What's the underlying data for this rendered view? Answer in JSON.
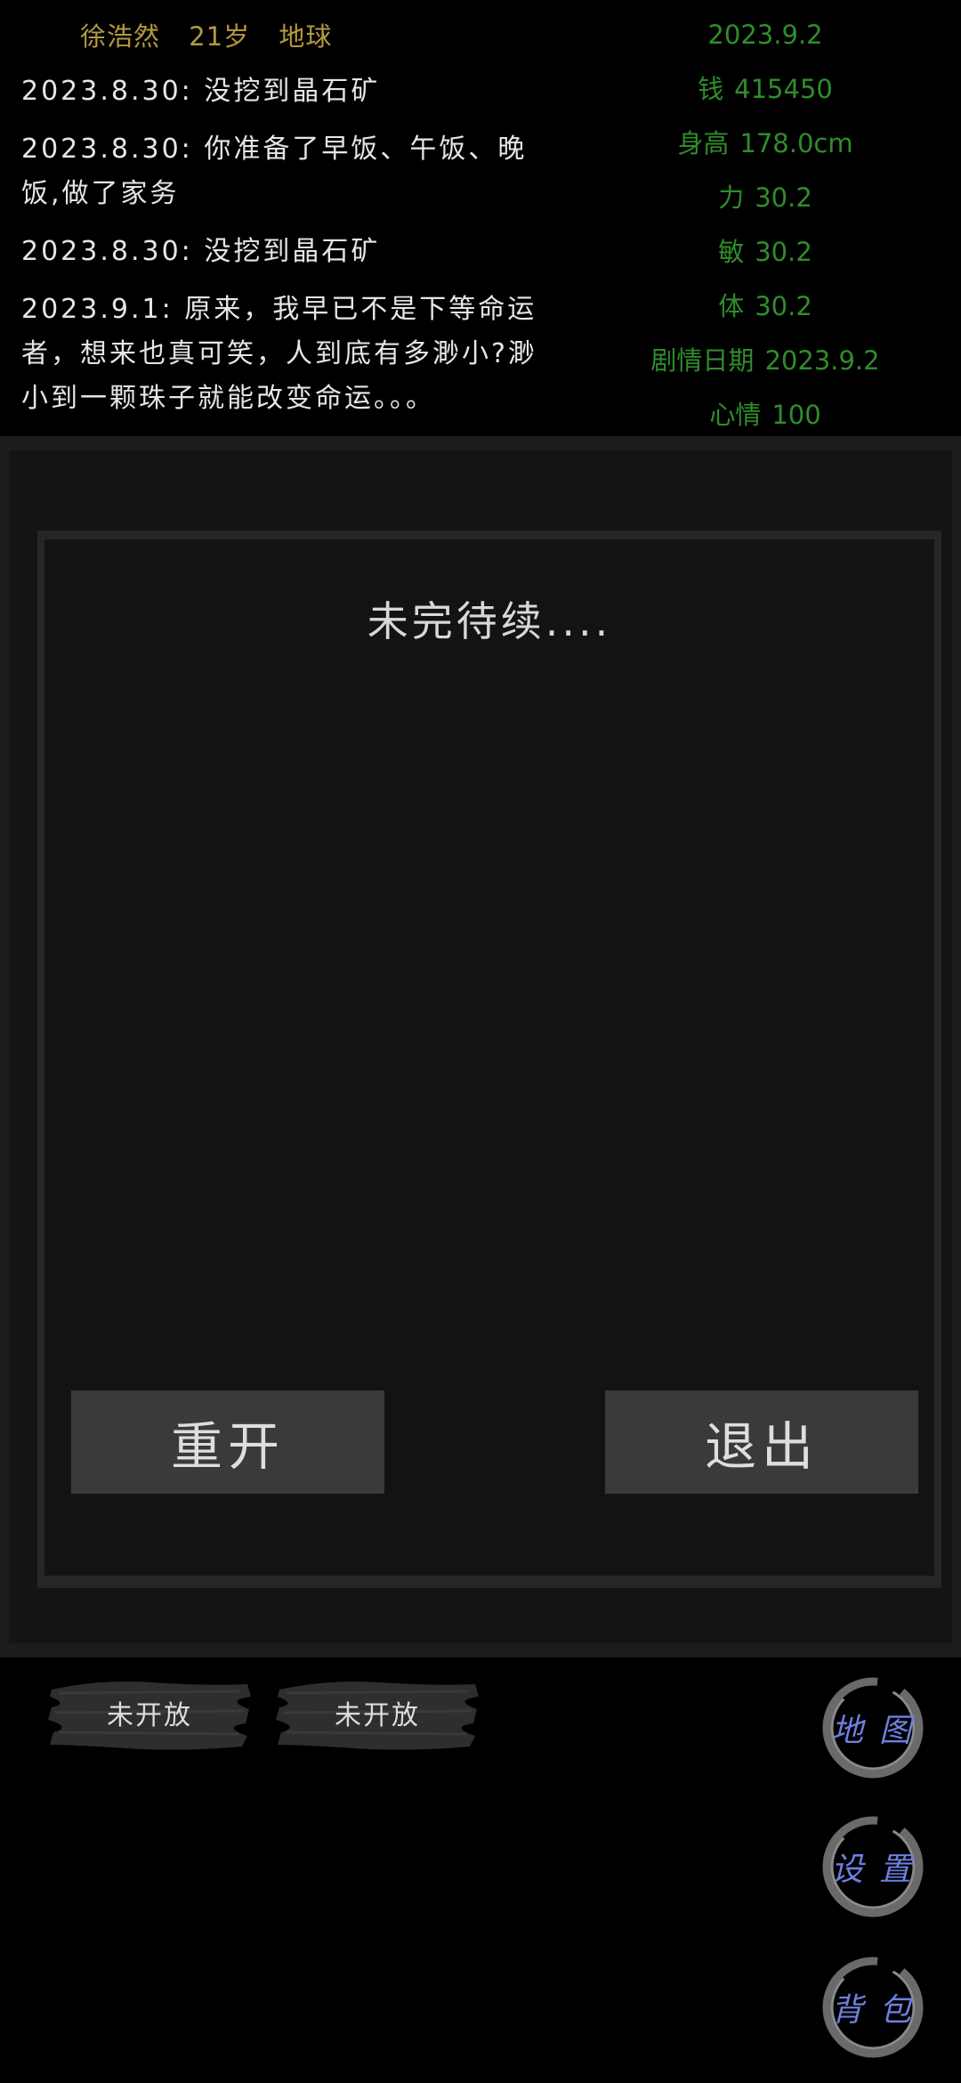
{
  "header": {
    "name": "徐浩然",
    "age": "21岁",
    "location": "地球"
  },
  "log": [
    "2023.8.30: 没挖到晶石矿",
    "2023.8.30: 你准备了早饭、午饭、晚饭,做了家务",
    "2023.8.30: 没挖到晶石矿",
    "2023.9.1: 原来，我早已不是下等命运者，想来也真可笑，人到底有多渺小?渺小到一颗珠子就能改变命运。。。"
  ],
  "stats": {
    "date": "2023.9.2",
    "money_label": "钱",
    "money": "415450",
    "height_label": "身高",
    "height": "178.0cm",
    "strength_label": "力",
    "strength": "30.2",
    "agility_label": "敏",
    "agility": "30.2",
    "constitution_label": "体",
    "constitution": "30.2",
    "story_date_label": "剧情日期",
    "story_date": "2023.9.2",
    "mood_label": "心情",
    "mood": "100"
  },
  "dialog": {
    "title": "未完待续....",
    "restart_label": "重开",
    "exit_label": "退出"
  },
  "bottom": {
    "locked_1": "未开放",
    "locked_2": "未开放",
    "map_label": "地图",
    "settings_label": "设置",
    "bag_label": "背包"
  },
  "colors": {
    "identity": "#b39a3e",
    "stats": "#2f8d2b",
    "ring_text": "#6f7fe0"
  }
}
